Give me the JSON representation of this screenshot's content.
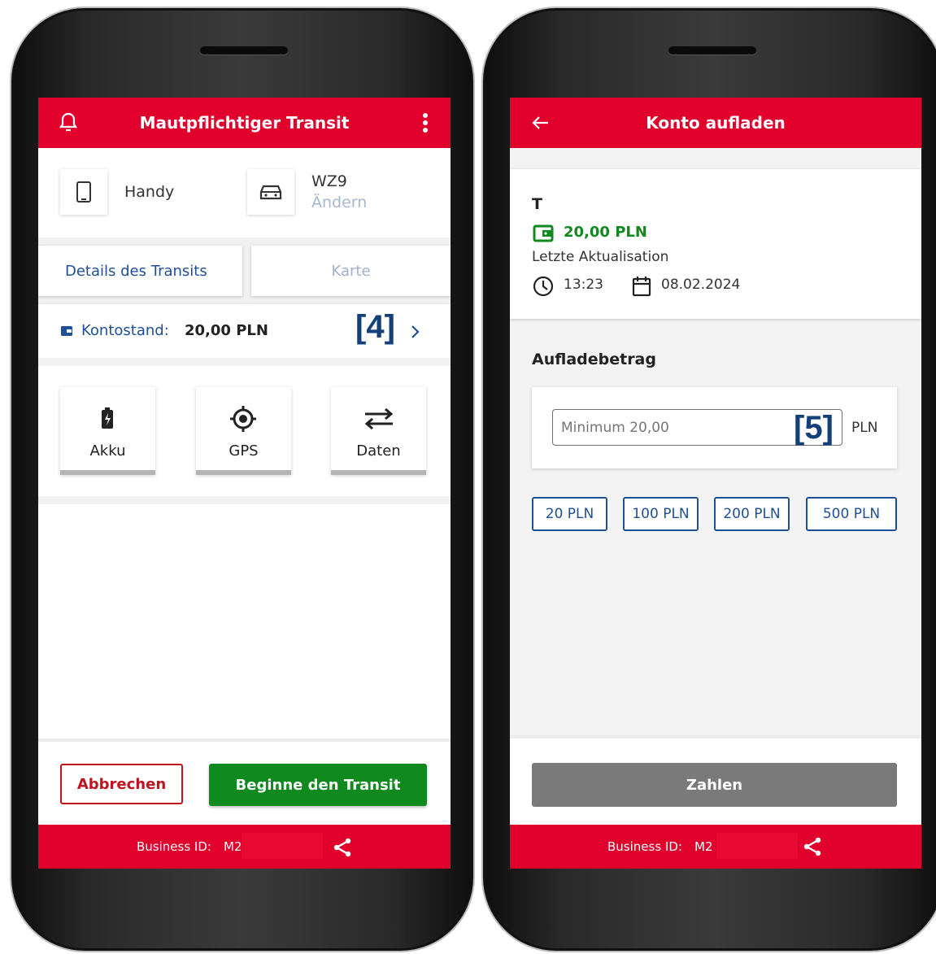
{
  "left": {
    "header": {
      "title": "Mautpflichtiger Transit"
    },
    "device": {
      "label": "Handy"
    },
    "vehicle": {
      "plate": "WZ9",
      "change_label": "Ändern"
    },
    "tabs": [
      {
        "label": "Details des Transits"
      },
      {
        "label": "Karte"
      }
    ],
    "balance": {
      "label": "Kontostand:",
      "value": "20,00 PLN",
      "marker": "[4]"
    },
    "status": [
      {
        "label": "Akku",
        "icon": "battery-charging-icon"
      },
      {
        "label": "GPS",
        "icon": "gps-target-icon"
      },
      {
        "label": "Daten",
        "icon": "data-transfer-icon"
      }
    ],
    "actions": {
      "cancel": "Abbrechen",
      "start": "Beginne den Transit"
    },
    "footer": {
      "business_label": "Business ID:",
      "business_value": "M2"
    }
  },
  "right": {
    "header": {
      "title": "Konto aufladen"
    },
    "account": {
      "name": "T",
      "balance": "20,00 PLN",
      "last_update_label": "Letzte Aktualisation",
      "time": "13:23",
      "date": "08.02.2024"
    },
    "topup": {
      "section_title": "Aufladebetrag",
      "placeholder": "Minimum 20,00",
      "currency": "PLN",
      "marker": "[5]",
      "presets": [
        "20 PLN",
        "100 PLN",
        "200 PLN",
        "500 PLN"
      ]
    },
    "pay_button": "Zahlen",
    "footer": {
      "business_label": "Business ID:",
      "business_value": "M2"
    }
  },
  "colors": {
    "brand_red": "#e0002b",
    "link_blue": "#1f4f96",
    "success_green": "#10891f",
    "disabled_gray": "#7a7a7a"
  }
}
